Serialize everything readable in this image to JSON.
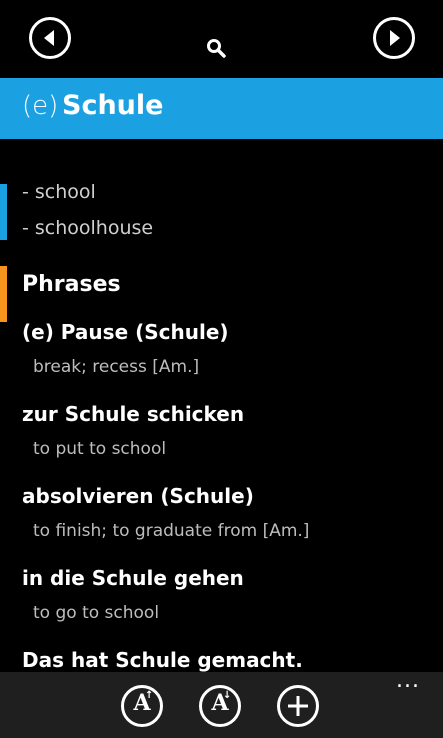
{
  "nav": {
    "back_icon": "circle-left-arrow-icon",
    "forward_icon": "circle-right-arrow-icon",
    "search_icon": "search-icon"
  },
  "entry": {
    "article": "(e)",
    "word": "Schule",
    "header_color": "#1ba1e2",
    "translations": [
      "- school",
      "- schoolhouse"
    ]
  },
  "phrases": {
    "title": "Phrases",
    "accent_color": "#f7941d",
    "items": [
      {
        "phrase": "(e) Pause (Schule)",
        "translation": "break; recess [Am.]"
      },
      {
        "phrase": "zur Schule schicken",
        "translation": "to put to school"
      },
      {
        "phrase": "absolvieren (Schule)",
        "translation": "to finish; to graduate from [Am.]"
      },
      {
        "phrase": "in die Schule gehen",
        "translation": "to go to school"
      },
      {
        "phrase": "Das hat Schule gemacht.",
        "translation": ""
      }
    ]
  },
  "appbar": {
    "font_glyph": "A",
    "font_increase_mark": "↑",
    "font_decrease_mark": "↓",
    "more": "..."
  }
}
